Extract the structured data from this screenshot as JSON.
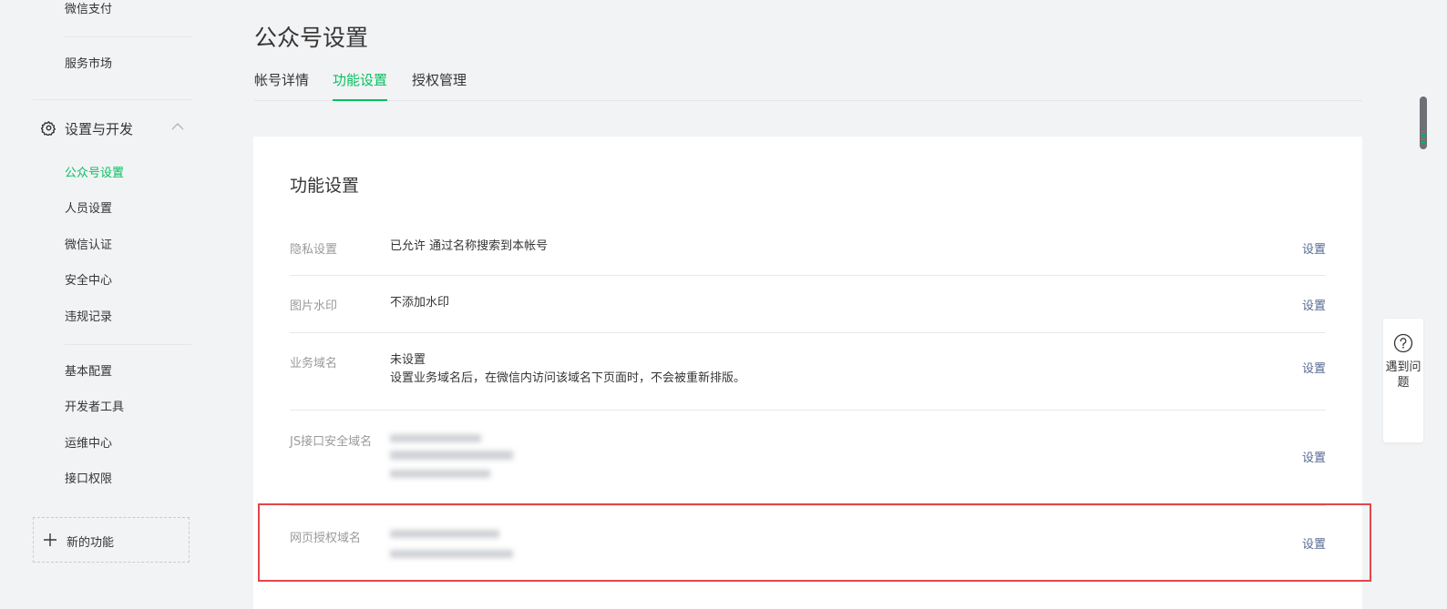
{
  "sidebar": {
    "top_items": [
      "微信支付",
      "服务市场"
    ],
    "group": {
      "label": "设置与开发",
      "expanded": true
    },
    "items": [
      "公众号设置",
      "人员设置",
      "微信认证",
      "安全中心",
      "违规记录"
    ],
    "items2": [
      "基本配置",
      "开发者工具",
      "运维中心",
      "接口权限"
    ],
    "new_feature": "新的功能"
  },
  "header": {
    "title": "公众号设置",
    "tabs": [
      {
        "label": "帐号详情",
        "active": false
      },
      {
        "label": "功能设置",
        "active": true
      },
      {
        "label": "授权管理",
        "active": false
      }
    ]
  },
  "card": {
    "title": "功能设置",
    "rows": [
      {
        "label": "隐私设置",
        "values": [
          "已允许 通过名称搜索到本帐号"
        ],
        "action": "设置"
      },
      {
        "label": "图片水印",
        "values": [
          "不添加水印"
        ],
        "action": "设置"
      },
      {
        "label": "业务域名",
        "values": [
          "未设置",
          "设置业务域名后，在微信内访问该域名下页面时，不会被重新排版。"
        ],
        "action": "设置"
      },
      {
        "label": "JS接口安全域名",
        "values": [],
        "redacted": true,
        "action": "设置"
      },
      {
        "label": "网页授权域名",
        "values": [],
        "redacted": true,
        "action": "设置"
      }
    ]
  },
  "help": {
    "label": "遇到问题"
  },
  "colors": {
    "accent": "#07c160",
    "link": "#576b95",
    "highlight": "#e0474b"
  }
}
